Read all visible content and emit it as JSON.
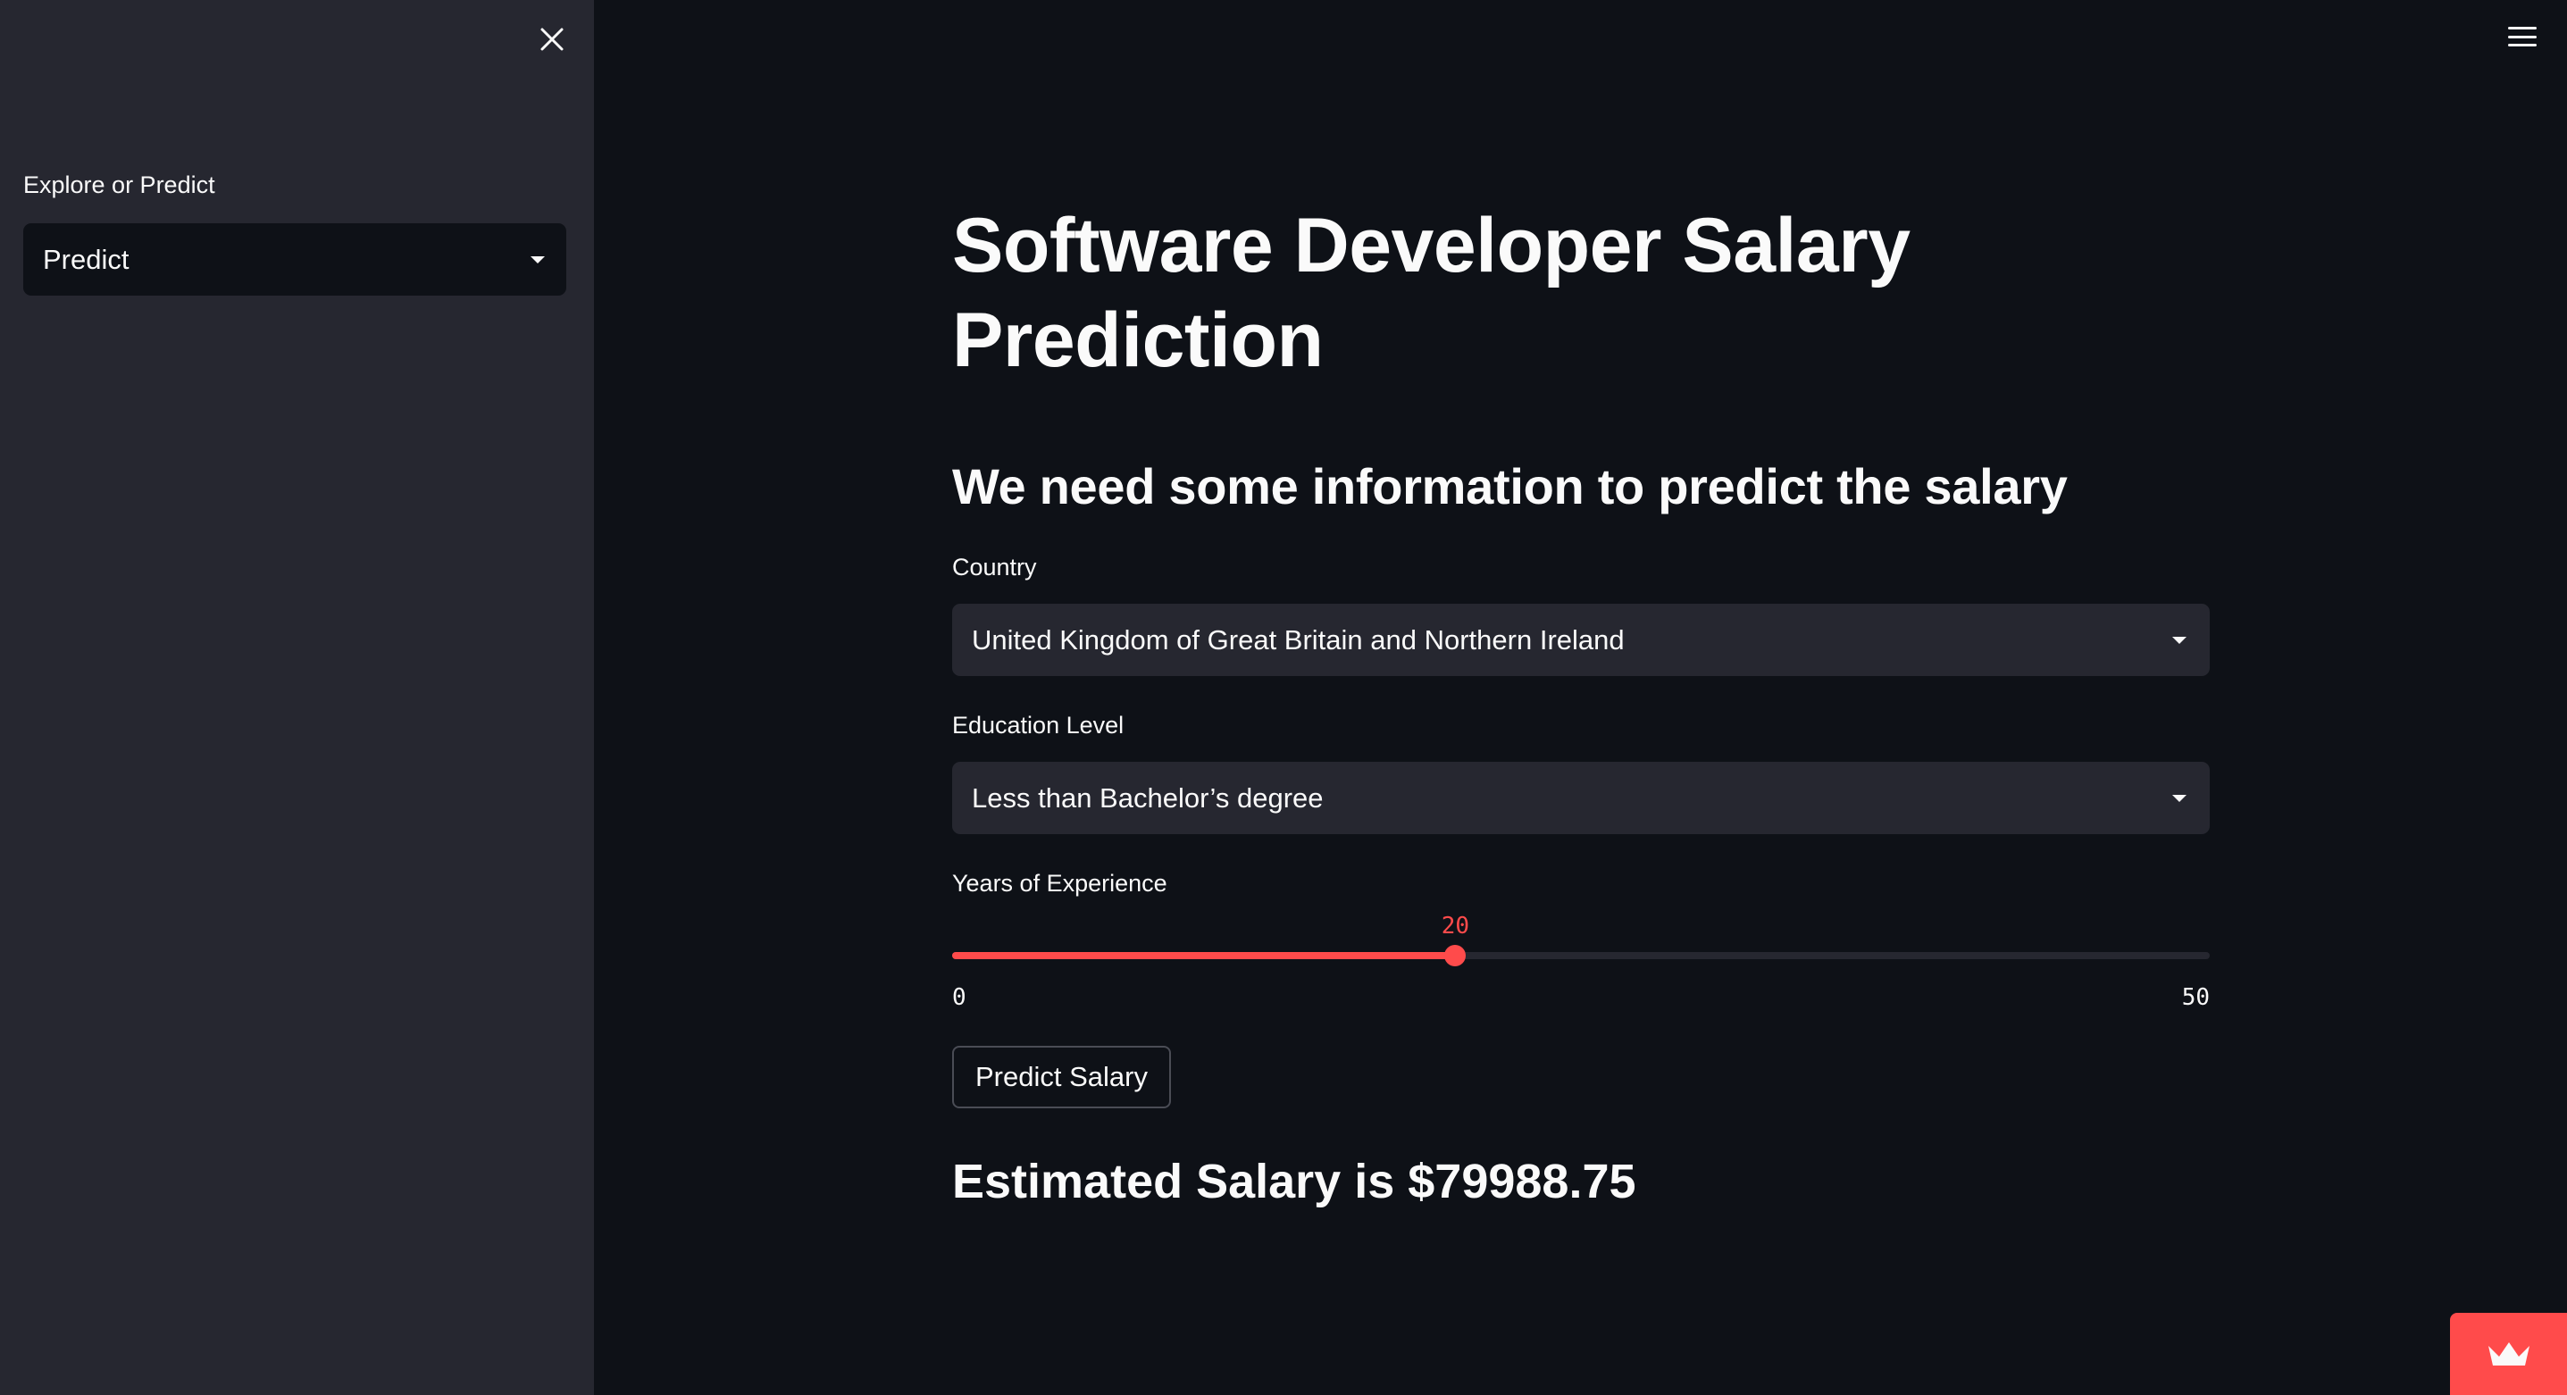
{
  "sidebar": {
    "close_icon": "close-icon",
    "label": "Explore or Predict",
    "select_value": "Predict"
  },
  "header": {
    "menu_icon": "hamburger-menu-icon"
  },
  "main": {
    "title": "Software Developer Salary Prediction",
    "subheader": "We need some information to predict the salary",
    "country": {
      "label": "Country",
      "value": "United Kingdom of Great Britain and Northern Ireland"
    },
    "education": {
      "label": "Education Level",
      "value": "Less than Bachelor’s degree"
    },
    "experience": {
      "label": "Years of Experience",
      "value": 20,
      "value_text": "20",
      "min": 0,
      "max": 50,
      "min_text": "0",
      "max_text": "50"
    },
    "button_label": "Predict Salary",
    "result": "Estimated Salary is $79988.75"
  },
  "badge": {
    "icon": "crown-icon"
  },
  "colors": {
    "accent": "#ff4b4b",
    "background": "#0e1117",
    "sidebar": "#262730"
  }
}
